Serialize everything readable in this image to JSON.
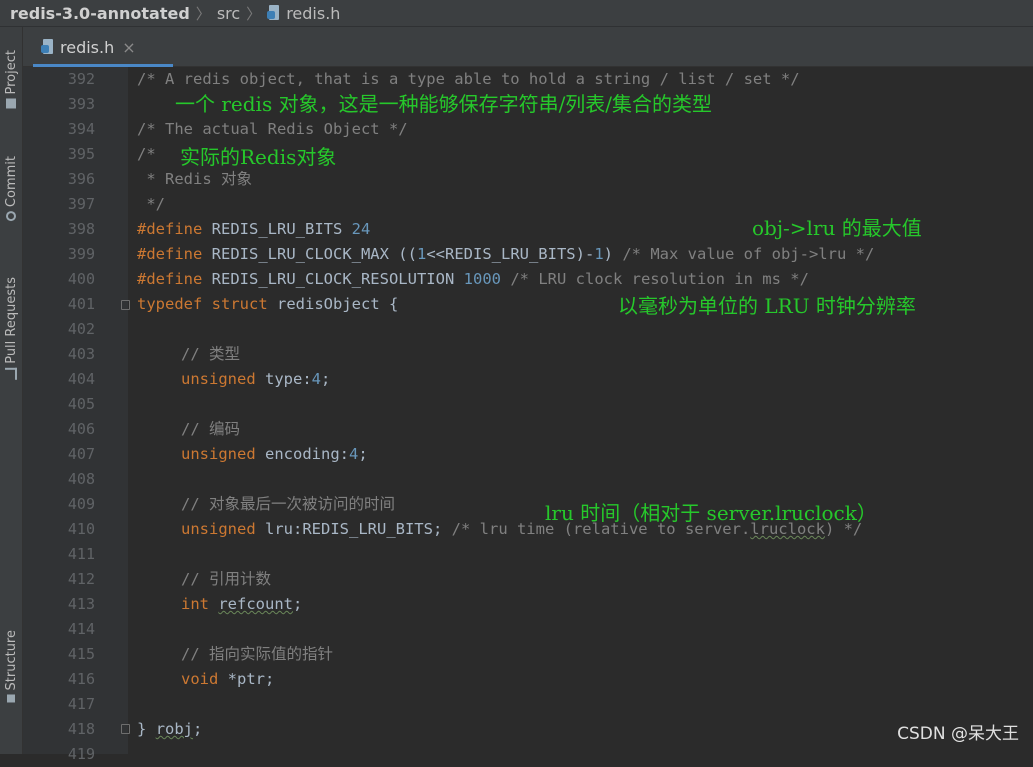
{
  "breadcrumb": {
    "project": "redis-3.0-annotated",
    "folder": "src",
    "file": "redis.h"
  },
  "tab": {
    "label": "redis.h",
    "close": "×"
  },
  "sidebar": {
    "project": "Project",
    "commit": "Commit",
    "pull_requests": "Pull Requests",
    "structure": "Structure"
  },
  "line_numbers": [
    "392",
    "393",
    "394",
    "395",
    "396",
    "397",
    "398",
    "399",
    "400",
    "401",
    "402",
    "403",
    "404",
    "405",
    "406",
    "407",
    "408",
    "409",
    "410",
    "411",
    "412",
    "413",
    "414",
    "415",
    "416",
    "417",
    "418",
    "419"
  ],
  "code": {
    "l392": "/* A redis object, that is a type able to hold a string / list / set */",
    "l394": "/* The actual Redis Object */",
    "l395": "/*",
    "l396": " * Redis 对象",
    "l397": " */",
    "define": "#define",
    "l398_name": "REDIS_LRU_BITS",
    "l398_val": "24",
    "l399_a": "REDIS_LRU_CLOCK_MAX ((",
    "l399_n1": "1",
    "l399_b": "<<REDIS_LRU_BITS)-",
    "l399_n2": "1",
    "l399_c": ")",
    "l399_cm": "/* Max value of obj->lru */",
    "l400_name": "REDIS_LRU_CLOCK_RESOLUTION",
    "l400_val": "1000",
    "l400_cm": "/* LRU clock resolution in ms */",
    "l401_kw": "typedef struct",
    "l401_rest": "redisObject {",
    "l403": "// 类型",
    "unsigned": "unsigned",
    "l404_rest": "type:",
    "l404_num": "4",
    "semi": ";",
    "l406": "// 编码",
    "l407_rest": "encoding:",
    "l407_num": "4",
    "l409": "// 对象最后一次被访问的时间",
    "l410_rest": "lru:REDIS_LRU_BITS;",
    "l410_cm1": "/* lru time (relative to server.",
    "l410_sq": "lruclock",
    "l410_cm2": ") */",
    "l412": "// 引用计数",
    "l413_kw": "int",
    "l413_rest": "refcount",
    "l415": "// 指向实际值的指针",
    "l416_kw": "void",
    "l416_rest": "*ptr;",
    "l418_a": "}",
    "l418_b": "robj",
    "l418_c": ";"
  },
  "annotations": {
    "a393": "一个 redis 对象，这是一种能够保存字符串/列表/集合的类型",
    "a395": "实际的Redis对象",
    "a398": "obj->lru 的最大值",
    "a401": "以毫秒为单位的 LRU 时钟分辨率",
    "a409": "lru 时间（相对于 server.lruclock）"
  },
  "watermark": "CSDN @呆大王",
  "colors": {
    "keyword": "#cc7832",
    "number": "#6897bb",
    "comment": "#808080",
    "annotation": "#26c82b",
    "background": "#2b2b2b"
  }
}
